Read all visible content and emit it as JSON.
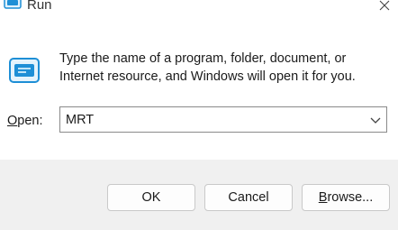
{
  "window": {
    "title": "Run",
    "title_icon": "run-icon",
    "close_icon": "close-icon"
  },
  "body": {
    "icon": "run-icon",
    "description_line1": "Type the name of a program, folder, document, or",
    "description_line2": "Internet resource, and Windows will open it for you."
  },
  "open_field": {
    "label_accel": "O",
    "label_rest": "pen:",
    "value": "MRT",
    "dropdown_icon": "chevron-down-icon"
  },
  "buttons": {
    "ok": "OK",
    "cancel": "Cancel",
    "browse_accel": "B",
    "browse_rest": "rowse..."
  },
  "colors": {
    "footer_bg": "#f0f0f0",
    "icon_blue": "#1e8fd6"
  }
}
